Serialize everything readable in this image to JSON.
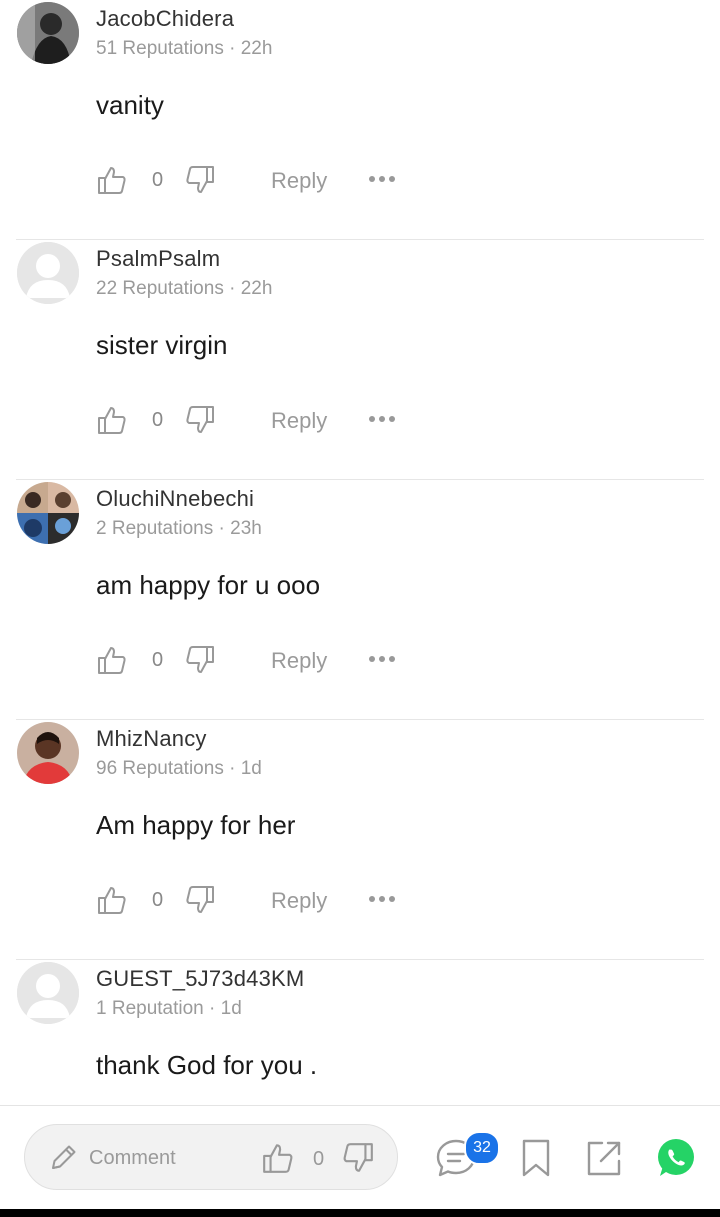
{
  "comments": [
    {
      "username": "JacobChidera",
      "meta": "51 Reputations · 22h",
      "text": "vanity",
      "likes": "0",
      "reply_label": "Reply",
      "avatar": "photo-dark"
    },
    {
      "username": "PsalmPsalm",
      "meta": "22 Reputations · 22h",
      "text": "sister virgin",
      "likes": "0",
      "reply_label": "Reply",
      "avatar": "default-user"
    },
    {
      "username": "OluchiNnebechi",
      "meta": "2 Reputations · 23h",
      "text": "am happy for u ooo",
      "likes": "0",
      "reply_label": "Reply",
      "avatar": "photo-collage"
    },
    {
      "username": "MhizNancy",
      "meta": "96 Reputations · 1d",
      "text": "Am happy for her",
      "likes": "0",
      "reply_label": "Reply",
      "avatar": "photo-red"
    },
    {
      "username": "GUEST_5J73d43KM",
      "meta": "1 Reputation · 1d",
      "text": "thank God for you .",
      "avatar": "default-user"
    }
  ],
  "bottom_bar": {
    "comment_placeholder": "Comment",
    "likes": "0",
    "comments_badge": "32",
    "icons": [
      "pencil-icon",
      "thumbs-up-icon",
      "thumbs-down-icon",
      "comments-icon",
      "bookmark-icon",
      "share-icon",
      "whatsapp-icon"
    ]
  },
  "colors": {
    "accent": "#1a73e8",
    "whatsapp": "#25d366",
    "meta_text": "#9a9a9a"
  }
}
